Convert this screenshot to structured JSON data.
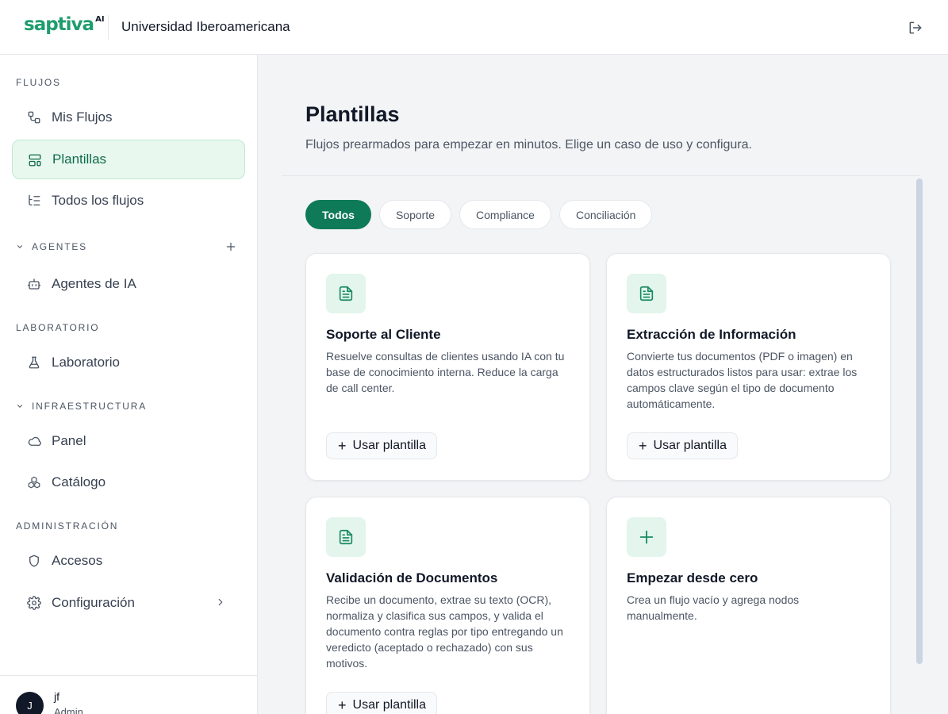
{
  "header": {
    "logo_text": "saptiva",
    "logo_sup": "AI",
    "org_name": "Universidad Iberoamericana",
    "logout_icon": "logout-icon"
  },
  "sidebar": {
    "sections": {
      "flujos": "FLUJOS",
      "agentes": "AGENTES",
      "laboratorio": "LABORATORIO",
      "infraestructura": "INFRAESTRUCTURA",
      "administracion": "ADMINISTRACIÓN"
    },
    "items": {
      "mis_flujos": "Mis Flujos",
      "plantillas": "Plantillas",
      "todos_flujos": "Todos los flujos",
      "agentes_ia": "Agentes de IA",
      "laboratorio": "Laboratorio",
      "panel": "Panel",
      "catalogo": "Catálogo",
      "accesos": "Accesos",
      "configuracion": "Configuración"
    },
    "active_item": "Plantillas",
    "user": {
      "initial": "J",
      "name": "jf",
      "role": "Admin"
    }
  },
  "main": {
    "title": "Plantillas",
    "subtitle": "Flujos prearmados para empezar en minutos. Elige un caso de uso y configura.",
    "filters": [
      "Todos",
      "Soporte",
      "Compliance",
      "Conciliación"
    ],
    "active_filter": "Todos",
    "use_template_label": "Usar plantilla",
    "cards": [
      {
        "title": "Soporte al Cliente",
        "description": "Resuelve consultas de clientes usando IA con tu base de conocimiento interna. Reduce la carga de call center.",
        "icon": "document-icon"
      },
      {
        "title": "Extracción de Información",
        "description": "Convierte tus documentos (PDF o imagen) en datos estructurados listos para usar: extrae los campos clave según el tipo de documento automáticamente.",
        "icon": "document-icon"
      },
      {
        "title": "Validación de Documentos",
        "description": "Recibe un documento, extrae su texto (OCR), normaliza y clasifica sus campos, y valida el documento contra reglas por tipo entregando un veredicto (aceptado o rechazado) con sus motivos.",
        "icon": "document-icon"
      },
      {
        "title": "Empezar desde cero",
        "description": "Crea un flujo vacío y agrega nodos manualmente.",
        "icon": "plus-icon"
      }
    ]
  },
  "colors": {
    "brand_green": "#1f9d6e",
    "active_chip": "#0f7a57",
    "active_nav_bg": "#e9f8ef"
  }
}
